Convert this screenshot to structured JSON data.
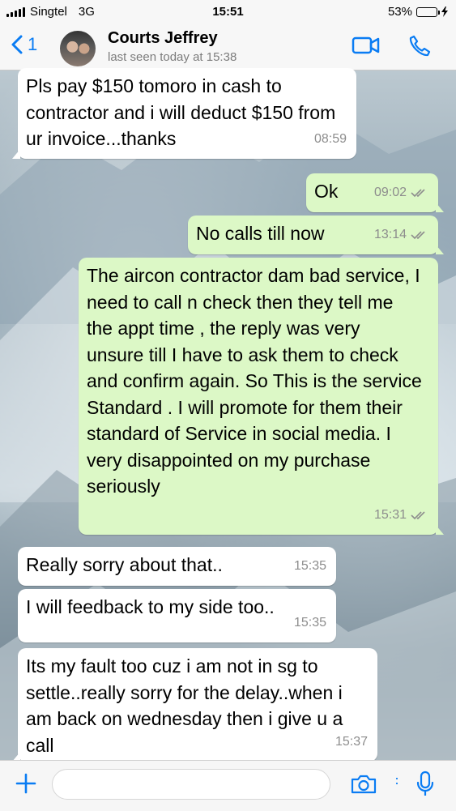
{
  "status_bar": {
    "carrier": "Singtel",
    "network": "3G",
    "time": "15:51",
    "battery_percent": "53%",
    "battery_level": 0.53
  },
  "header": {
    "back_count": "1",
    "contact_name": "Courts Jeffrey",
    "last_seen": "last seen today at 15:38",
    "icons": [
      "chevron-left-icon",
      "video-call-icon",
      "phone-icon"
    ]
  },
  "messages": [
    {
      "direction": "in",
      "text": "Pls pay $150 tomoro in cash to contractor and i will deduct $150 from ur invoice...thanks",
      "time": "08:59"
    },
    {
      "direction": "out",
      "text": "Ok",
      "time": "09:02"
    },
    {
      "direction": "out",
      "text": "No calls till now",
      "time": "13:14"
    },
    {
      "direction": "out",
      "text": "The aircon contractor dam bad service, I need to call n check then they tell me the appt time , the reply was very unsure till I have to ask them to check and confirm again. So This is the service Standard . I will promote for them their standard of Service in social media. I very disappointed on my purchase seriously",
      "time": "15:31"
    },
    {
      "direction": "in",
      "text": "Really sorry about that..",
      "time": "15:35"
    },
    {
      "direction": "in",
      "text": "I will feedback to my side too..",
      "time": "15:35"
    },
    {
      "direction": "in",
      "text": "Its my fault too cuz i am not in sg to settle..really sorry for the delay..when i am back on wednesday then i give u a call",
      "time": "15:37"
    }
  ],
  "input_bar": {
    "placeholder": "",
    "icons": [
      "plus-icon",
      "camera-icon",
      "microphone-icon"
    ]
  },
  "colors": {
    "accent": "#0a7cf3",
    "outgoing_bubble": "#dcf8c6",
    "incoming_bubble": "#ffffff"
  }
}
